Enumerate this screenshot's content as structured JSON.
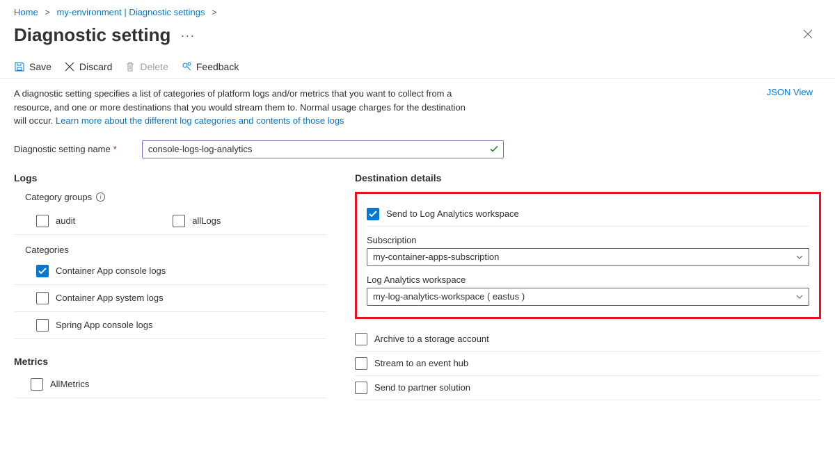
{
  "breadcrumb": {
    "home": "Home",
    "env": "my-environment | Diagnostic settings"
  },
  "page_title": "Diagnostic setting",
  "toolbar": {
    "save": "Save",
    "discard": "Discard",
    "delete": "Delete",
    "feedback": "Feedback"
  },
  "description": {
    "text": "A diagnostic setting specifies a list of categories of platform logs and/or metrics that you want to collect from a resource, and one or more destinations that you would stream them to. Normal usage charges for the destination will occur. ",
    "link": "Learn more about the different log categories and contents of those logs"
  },
  "json_view": "JSON View",
  "name_field": {
    "label": "Diagnostic setting name",
    "value": "console-logs-log-analytics"
  },
  "logs": {
    "title": "Logs",
    "category_groups_label": "Category groups",
    "groups": {
      "audit": "audit",
      "allLogs": "allLogs"
    },
    "categories_label": "Categories",
    "categories": [
      {
        "label": "Container App console logs",
        "checked": true
      },
      {
        "label": "Container App system logs",
        "checked": false
      },
      {
        "label": "Spring App console logs",
        "checked": false
      }
    ]
  },
  "metrics": {
    "title": "Metrics",
    "all": "AllMetrics"
  },
  "destinations": {
    "title": "Destination details",
    "log_analytics": {
      "label": "Send to Log Analytics workspace",
      "subscription_label": "Subscription",
      "subscription_value": "my-container-apps-subscription",
      "workspace_label": "Log Analytics workspace",
      "workspace_value": "my-log-analytics-workspace ( eastus )"
    },
    "archive": "Archive to a storage account",
    "eventhub": "Stream to an event hub",
    "partner": "Send to partner solution"
  }
}
